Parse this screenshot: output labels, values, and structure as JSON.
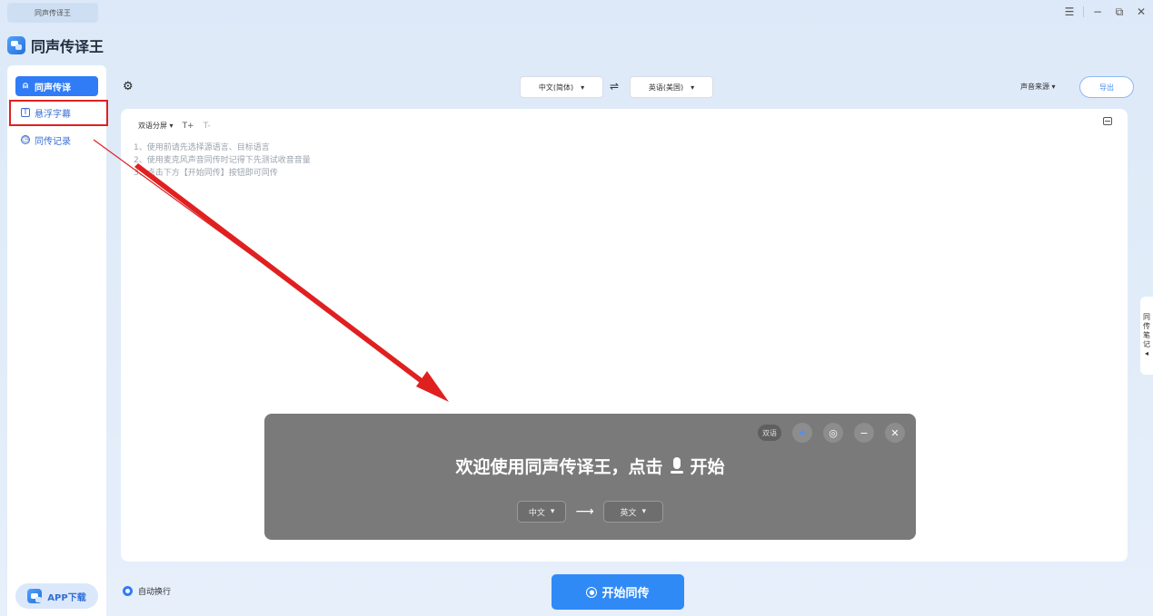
{
  "window": {
    "tab_title": "同声传译王",
    "menu_icon": "menu-icon",
    "min_icon": "minimize-icon",
    "max_icon": "restore-icon",
    "close_icon": "close-icon"
  },
  "app": {
    "title": "同声传译王"
  },
  "sidebar": {
    "items": [
      {
        "label": "同声传译",
        "icon": "person-icon",
        "active": true
      },
      {
        "label": "悬浮字幕",
        "icon": "subtitle-icon",
        "active": false
      },
      {
        "label": "同传记录",
        "icon": "clock-icon",
        "active": false
      }
    ],
    "app_download": "APP下载"
  },
  "toolbar": {
    "source_lang": "中文(简体)",
    "target_lang": "英语(美国)",
    "sound_source": "声音来源",
    "export": "导出"
  },
  "panel": {
    "mode": "双语分屏",
    "font_up": "T+",
    "font_down": "T-",
    "instructions": [
      "1、使用前请先选择源语言、目标语言",
      "2、使用麦克风声音同传时记得下先测试收音音量",
      "3、点击下方【开始同传】按钮即可同传"
    ]
  },
  "side_tab": {
    "chars": [
      "同",
      "传",
      "笔",
      "记"
    ]
  },
  "overlay": {
    "badge": "双语",
    "welcome_before": "欢迎使用同声传译王，点击",
    "welcome_after": "开始",
    "source_lang": "中文",
    "target_lang": "英文"
  },
  "bottom": {
    "auto_wrap": "自动换行",
    "start": "开始同传"
  },
  "colors": {
    "accent": "#2f7cf6",
    "highlight": "#e02020",
    "overlay": "#7a7a7a"
  }
}
